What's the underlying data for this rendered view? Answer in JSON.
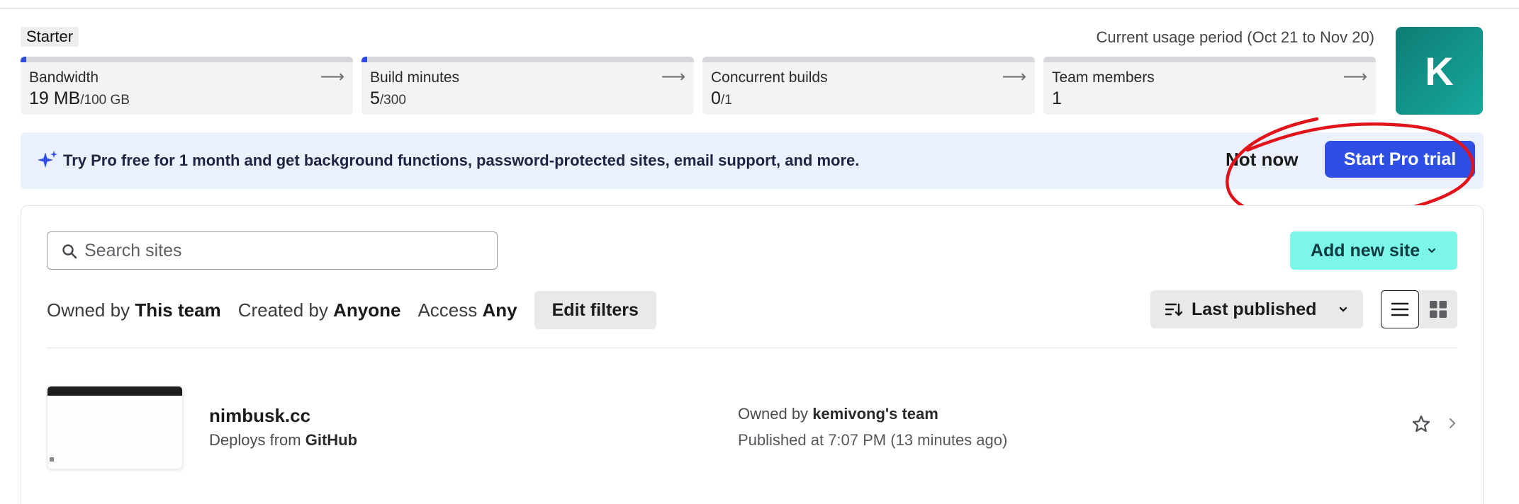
{
  "header": {
    "plan_badge": "Starter",
    "usage_period": "Current usage period (Oct 21 to Nov 20)",
    "avatar_initial": "K"
  },
  "usage_cards": [
    {
      "label": "Bandwidth",
      "value": "19 MB",
      "limit": "/100 GB",
      "usage_fraction": 0.0002
    },
    {
      "label": "Build minutes",
      "value": "5",
      "limit": "/300",
      "usage_fraction": 0.017
    },
    {
      "label": "Concurrent builds",
      "value": "0",
      "limit": "/1",
      "usage_fraction": 0
    },
    {
      "label": "Team members",
      "value": "1",
      "limit": "",
      "usage_fraction": 0
    }
  ],
  "promo": {
    "text": "Try Pro free for 1 month and get background functions, password-protected sites, email support, and more.",
    "dismiss_label": "Not now",
    "cta_label": "Start Pro trial",
    "annotation_color": "#e0141a"
  },
  "sites_panel": {
    "search_placeholder": "Search sites",
    "add_site_label": "Add new site",
    "filters": [
      {
        "prefix": "Owned by",
        "value": "This team"
      },
      {
        "prefix": "Created by",
        "value": "Anyone"
      },
      {
        "prefix": "Access",
        "value": "Any"
      }
    ],
    "edit_filters_label": "Edit filters",
    "sort_label": "Last published",
    "sites": [
      {
        "name": "nimbusk.cc",
        "deploy_prefix": "Deploys from",
        "deploy_source": "GitHub",
        "owner_prefix": "Owned by",
        "owner": "kemivong's team",
        "published": "Published at 7:07 PM (13 minutes ago)"
      }
    ]
  },
  "colors": {
    "accent": "#2f4ee3",
    "add_site_bg": "#7cf6e8",
    "avatar_bg": "#13978d",
    "promo_bg": "#ebf1fe"
  }
}
